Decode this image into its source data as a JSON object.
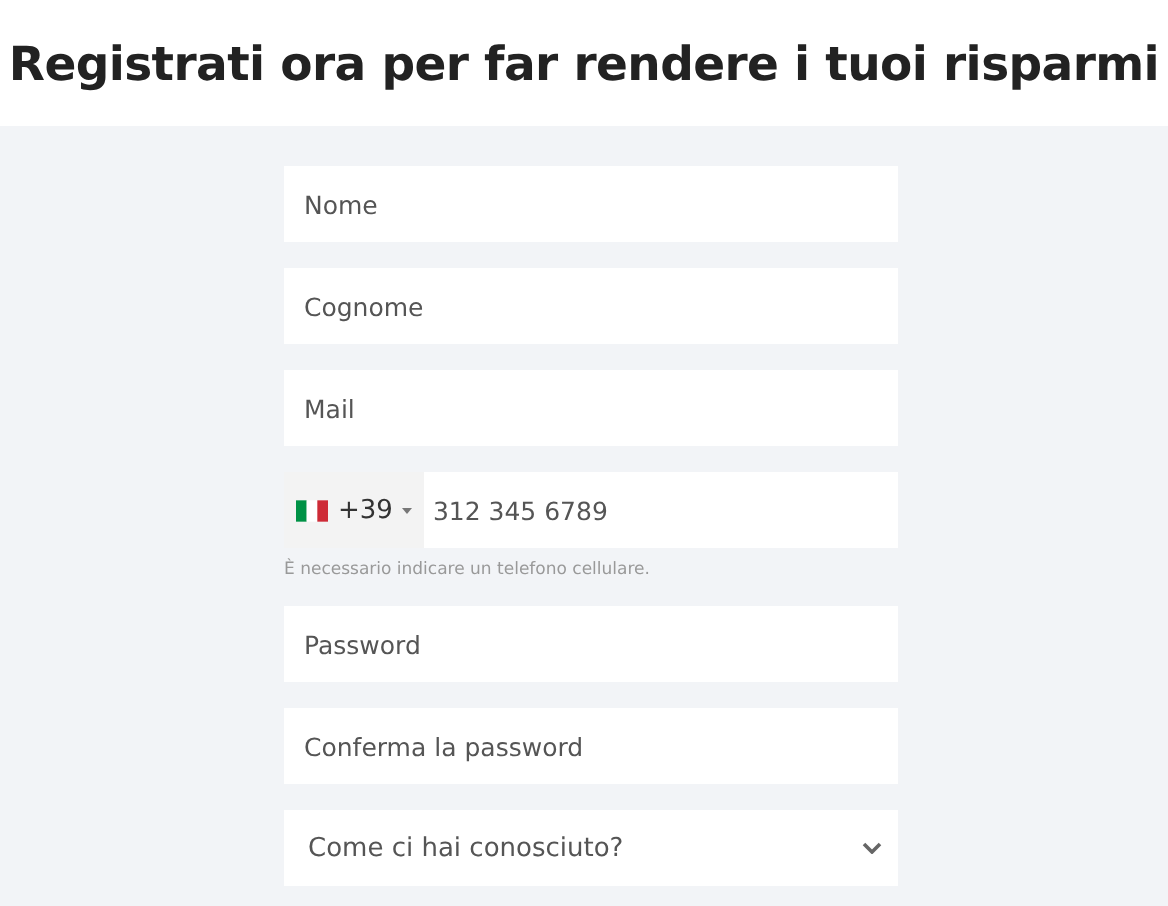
{
  "title": "Registrati ora per far rendere i tuoi risparmi",
  "fields": [
    {
      "kind": "text",
      "placeholder": "Nome"
    },
    {
      "kind": "text",
      "placeholder": "Cognome"
    },
    {
      "kind": "text",
      "placeholder": "Mail"
    },
    {
      "kind": "phone",
      "prefix": "+39",
      "placeholder": "312 345 6789",
      "hint": "È necessario indicare un telefono cellulare."
    },
    {
      "kind": "password",
      "placeholder": "Password"
    },
    {
      "kind": "password",
      "placeholder": "Conferma la password"
    },
    {
      "kind": "select",
      "placeholder": "Come ci hai conosciuto?"
    }
  ]
}
